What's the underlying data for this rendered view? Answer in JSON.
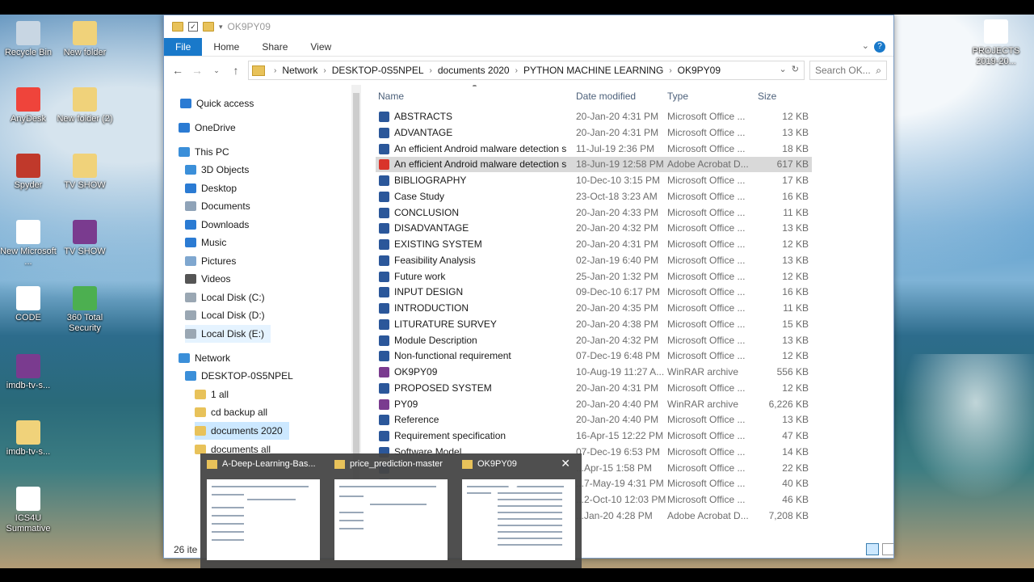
{
  "desktop": {
    "icons": [
      {
        "label": "Recycle Bin",
        "icon": "recycle-bin-icon",
        "color": "#c8d6e3"
      },
      {
        "label": "New folder",
        "icon": "folder-icon",
        "color": "#f0d27a"
      },
      {
        "label": "AnyDesk",
        "icon": "anydesk-icon",
        "color": "#ef443b"
      },
      {
        "label": "New folder (2)",
        "icon": "folder-icon",
        "color": "#f0d27a"
      },
      {
        "label": "Spyder",
        "icon": "spyder-icon",
        "color": "#c0392b"
      },
      {
        "label": "TV SHOW",
        "icon": "folder-icon",
        "color": "#f0d27a"
      },
      {
        "label": "New Microsoft ...",
        "icon": "word-doc-icon",
        "color": "#ffffff"
      },
      {
        "label": "TV SHOW",
        "icon": "winrar-icon",
        "color": "#7a3b8f"
      },
      {
        "label": "CODE",
        "icon": "word-doc-icon",
        "color": "#ffffff"
      },
      {
        "label": "360 Total Security",
        "icon": "security-icon",
        "color": "#4caf50"
      },
      {
        "label": "imdb-tv-s...",
        "icon": "winrar-icon",
        "color": "#7a3b8f"
      },
      {
        "label": "imdb-tv-s...",
        "icon": "folder-icon",
        "color": "#f0d27a"
      },
      {
        "label": "ICS4U Summative",
        "icon": "pdf-icon",
        "color": "#ffffff"
      },
      {
        "label": "PROJECTS 2019-20...",
        "icon": "pdf-icon",
        "color": "#ffffff"
      }
    ]
  },
  "explorer": {
    "title": "OK9PY09",
    "ribbon_tabs": [
      "File",
      "Home",
      "Share",
      "View"
    ],
    "breadcrumb": [
      "Network",
      "DESKTOP-0S5NPEL",
      "documents 2020",
      "PYTHON MACHINE LEARNING",
      "OK9PY09"
    ],
    "search_placeholder": "Search OK...",
    "nav_items": [
      {
        "label": "Quick access",
        "icon": "star-icon",
        "color": "#2b7bd3"
      },
      {
        "label": "OneDrive",
        "icon": "cloud-icon",
        "color": "#2b7bd3"
      },
      {
        "label": "This PC",
        "icon": "computer-icon",
        "color": "#3b8fd9"
      },
      {
        "label": "3D Objects",
        "icon": "cube-icon",
        "color": "#3b8fd9"
      },
      {
        "label": "Desktop",
        "icon": "desktop-folder-icon",
        "color": "#2b7bd3"
      },
      {
        "label": "Documents",
        "icon": "documents-folder-icon",
        "color": "#8fa3b8"
      },
      {
        "label": "Downloads",
        "icon": "download-icon",
        "color": "#2b7bd3"
      },
      {
        "label": "Music",
        "icon": "music-icon",
        "color": "#2b7bd3"
      },
      {
        "label": "Pictures",
        "icon": "pictures-folder-icon",
        "color": "#7fa7cf"
      },
      {
        "label": "Videos",
        "icon": "videos-folder-icon",
        "color": "#555555"
      },
      {
        "label": "Local Disk (C:)",
        "icon": "drive-icon",
        "color": "#9aa7b3"
      },
      {
        "label": "Local Disk (D:)",
        "icon": "drive-icon",
        "color": "#9aa7b3"
      },
      {
        "label": "Local Disk (E:)",
        "icon": "drive-icon",
        "color": "#9aa7b3"
      },
      {
        "label": "Network",
        "icon": "network-icon",
        "color": "#3b8fd9"
      },
      {
        "label": "DESKTOP-0S5NPEL",
        "icon": "computer-icon",
        "color": "#3b8fd9"
      },
      {
        "label": "1 all",
        "icon": "folder-icon",
        "color": "#e8c25a"
      },
      {
        "label": "cd backup all",
        "icon": "folder-icon",
        "color": "#e8c25a"
      },
      {
        "label": "documents 2020",
        "icon": "folder-icon",
        "color": "#e8c25a"
      },
      {
        "label": "documents all",
        "icon": "folder-icon",
        "color": "#e8c25a"
      }
    ],
    "columns": {
      "name": "Name",
      "date": "Date modified",
      "type": "Type",
      "size": "Size"
    },
    "files": [
      {
        "name": "ABSTRACTS",
        "date": "20-Jan-20 4:31 PM",
        "type": "Microsoft Office ...",
        "size": "12 KB",
        "icon": "word-doc-icon"
      },
      {
        "name": "ADVANTAGE",
        "date": "20-Jan-20 4:31 PM",
        "type": "Microsoft Office ...",
        "size": "13 KB",
        "icon": "word-doc-icon"
      },
      {
        "name": "An efficient Android malware detection s...",
        "date": "11-Jul-19 2:36 PM",
        "type": "Microsoft Office ...",
        "size": "18 KB",
        "icon": "word-doc-icon"
      },
      {
        "name": "An efficient Android malware detection s...",
        "date": "18-Jun-19 12:58 PM",
        "type": "Adobe Acrobat D...",
        "size": "617 KB",
        "icon": "pdf-icon"
      },
      {
        "name": "BIBLIOGRAPHY",
        "date": "10-Dec-10 3:15 PM",
        "type": "Microsoft Office ...",
        "size": "17 KB",
        "icon": "word-doc-icon"
      },
      {
        "name": "Case Study",
        "date": "23-Oct-18 3:23 AM",
        "type": "Microsoft Office ...",
        "size": "16 KB",
        "icon": "word-doc-icon"
      },
      {
        "name": "CONCLUSION",
        "date": "20-Jan-20 4:33 PM",
        "type": "Microsoft Office ...",
        "size": "11 KB",
        "icon": "word-doc-icon"
      },
      {
        "name": "DISADVANTAGE",
        "date": "20-Jan-20 4:32 PM",
        "type": "Microsoft Office ...",
        "size": "13 KB",
        "icon": "word-doc-icon"
      },
      {
        "name": "EXISTING SYSTEM",
        "date": "20-Jan-20 4:31 PM",
        "type": "Microsoft Office ...",
        "size": "12 KB",
        "icon": "word-doc-icon"
      },
      {
        "name": "Feasibility Analysis",
        "date": "02-Jan-19 6:40 PM",
        "type": "Microsoft Office ...",
        "size": "13 KB",
        "icon": "word-doc-icon"
      },
      {
        "name": "Future work",
        "date": "25-Jan-20 1:32 PM",
        "type": "Microsoft Office ...",
        "size": "12 KB",
        "icon": "word-doc-icon"
      },
      {
        "name": "INPUT DESIGN",
        "date": "09-Dec-10 6:17 PM",
        "type": "Microsoft Office ...",
        "size": "16 KB",
        "icon": "word-doc-icon"
      },
      {
        "name": "INTRODUCTION",
        "date": "20-Jan-20 4:35 PM",
        "type": "Microsoft Office ...",
        "size": "11 KB",
        "icon": "word-doc-icon"
      },
      {
        "name": "LITURATURE SURVEY",
        "date": "20-Jan-20 4:38 PM",
        "type": "Microsoft Office ...",
        "size": "15 KB",
        "icon": "word-doc-icon"
      },
      {
        "name": "Module Description",
        "date": "20-Jan-20 4:32 PM",
        "type": "Microsoft Office ...",
        "size": "13 KB",
        "icon": "word-doc-icon"
      },
      {
        "name": "Non-functional requirement",
        "date": "07-Dec-19 6:48 PM",
        "type": "Microsoft Office ...",
        "size": "12 KB",
        "icon": "word-doc-icon"
      },
      {
        "name": "OK9PY09",
        "date": "10-Aug-19 11:27 A...",
        "type": "WinRAR archive",
        "size": "556 KB",
        "icon": "winrar-icon"
      },
      {
        "name": "PROPOSED SYSTEM",
        "date": "20-Jan-20 4:31 PM",
        "type": "Microsoft Office ...",
        "size": "12 KB",
        "icon": "word-doc-icon"
      },
      {
        "name": "PY09",
        "date": "20-Jan-20 4:40 PM",
        "type": "WinRAR archive",
        "size": "6,226 KB",
        "icon": "winrar-icon"
      },
      {
        "name": "Reference",
        "date": "20-Jan-20 4:40 PM",
        "type": "Microsoft Office ...",
        "size": "13 KB",
        "icon": "word-doc-icon"
      },
      {
        "name": "Requirement specification",
        "date": "16-Apr-15 12:22 PM",
        "type": "Microsoft Office ...",
        "size": "47 KB",
        "icon": "word-doc-icon"
      },
      {
        "name": "Software Model",
        "date": "07-Dec-19 6:53 PM",
        "type": "Microsoft Office ...",
        "size": "14 KB",
        "icon": "word-doc-icon"
      },
      {
        "name": "",
        "date": "...Apr-15 1:58 PM",
        "type": "Microsoft Office ...",
        "size": "22 KB",
        "icon": "word-doc-icon"
      },
      {
        "name": "",
        "date": "...7-May-19 4:31 PM",
        "type": "Microsoft Office ...",
        "size": "40 KB",
        "icon": "word-doc-icon"
      },
      {
        "name": "",
        "date": "...2-Oct-10 12:03 PM",
        "type": "Microsoft Office ...",
        "size": "46 KB",
        "icon": "word-doc-icon"
      },
      {
        "name": "",
        "date": "...Jan-20 4:28 PM",
        "type": "Adobe Acrobat D...",
        "size": "7,208 KB",
        "icon": "pdf-icon"
      }
    ],
    "status": "26 ite"
  },
  "task_previews": [
    {
      "title": "A-Deep-Learning-Bas..."
    },
    {
      "title": "price_prediction-master"
    },
    {
      "title": "OK9PY09"
    }
  ],
  "colors": {
    "word": "#2b579a",
    "pdf": "#d9342b",
    "winrar": "#7a3b8f",
    "accent": "#1979ca"
  }
}
